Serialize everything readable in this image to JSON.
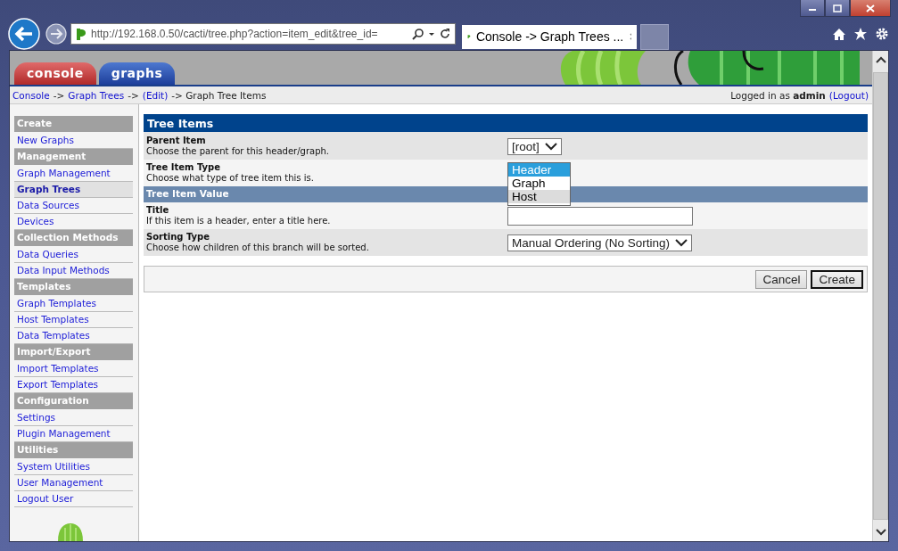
{
  "browser": {
    "address": "http://192.168.0.50/cacti/tree.php?action=item_edit&tree_id=",
    "tab_title": "Console -> Graph Trees ..."
  },
  "top_tabs": [
    {
      "label": "console",
      "kind": "console",
      "selected": false
    },
    {
      "label": "graphs",
      "kind": "graphs",
      "selected": false
    }
  ],
  "breadcrumb": [
    {
      "label": "Console",
      "link": true
    },
    {
      "label": "->",
      "link": false
    },
    {
      "label": "Graph Trees",
      "link": true
    },
    {
      "label": "->",
      "link": false
    },
    {
      "label": "(Edit)",
      "link": true
    },
    {
      "label": "-> Graph Tree Items",
      "link": false
    }
  ],
  "login": {
    "prefix": "Logged in as",
    "user": "admin",
    "logout": "(Logout)"
  },
  "sidebar": {
    "items": [
      {
        "label": "Create",
        "kind": "header"
      },
      {
        "label": "New Graphs",
        "kind": "link",
        "selected": false
      },
      {
        "label": "Management",
        "kind": "header"
      },
      {
        "label": "Graph Management",
        "kind": "link",
        "selected": false
      },
      {
        "label": "Graph Trees",
        "kind": "link",
        "selected": true
      },
      {
        "label": "Data Sources",
        "kind": "link",
        "selected": false
      },
      {
        "label": "Devices",
        "kind": "link",
        "selected": false
      },
      {
        "label": "Collection Methods",
        "kind": "header"
      },
      {
        "label": "Data Queries",
        "kind": "link",
        "selected": false
      },
      {
        "label": "Data Input Methods",
        "kind": "link",
        "selected": false
      },
      {
        "label": "Templates",
        "kind": "header"
      },
      {
        "label": "Graph Templates",
        "kind": "link",
        "selected": false
      },
      {
        "label": "Host Templates",
        "kind": "link",
        "selected": false
      },
      {
        "label": "Data Templates",
        "kind": "link",
        "selected": false
      },
      {
        "label": "Import/Export",
        "kind": "header"
      },
      {
        "label": "Import Templates",
        "kind": "link",
        "selected": false
      },
      {
        "label": "Export Templates",
        "kind": "link",
        "selected": false
      },
      {
        "label": "Configuration",
        "kind": "header"
      },
      {
        "label": "Settings",
        "kind": "link",
        "selected": false
      },
      {
        "label": "Plugin Management",
        "kind": "link",
        "selected": false
      },
      {
        "label": "Utilities",
        "kind": "header"
      },
      {
        "label": "System Utilities",
        "kind": "link",
        "selected": false
      },
      {
        "label": "User Management",
        "kind": "link",
        "selected": false
      },
      {
        "label": "Logout User",
        "kind": "link",
        "selected": false
      }
    ]
  },
  "form": {
    "title": "Tree Items",
    "rows": [
      {
        "kind": "select",
        "label": "Parent Item",
        "description": "Choose the parent for this header/graph.",
        "value": "[root]"
      },
      {
        "kind": "listbox",
        "label": "Tree Item Type",
        "description": "Choose what type of tree item this is.",
        "options": [
          {
            "label": "Header",
            "selected": true,
            "hovered": false
          },
          {
            "label": "Graph",
            "selected": false,
            "hovered": false
          },
          {
            "label": "Host",
            "selected": false,
            "hovered": true
          }
        ]
      },
      {
        "kind": "section",
        "label": "Tree Item Value"
      },
      {
        "kind": "text",
        "label": "Title",
        "description": "If this item is a header, enter a title here.",
        "value": ""
      },
      {
        "kind": "select",
        "label": "Sorting Type",
        "description": "Choose how children of this branch will be sorted.",
        "value": "Manual Ordering (No Sorting)"
      }
    ],
    "buttons": [
      {
        "label": "Cancel",
        "default": false
      },
      {
        "label": "Create",
        "default": true
      }
    ]
  }
}
